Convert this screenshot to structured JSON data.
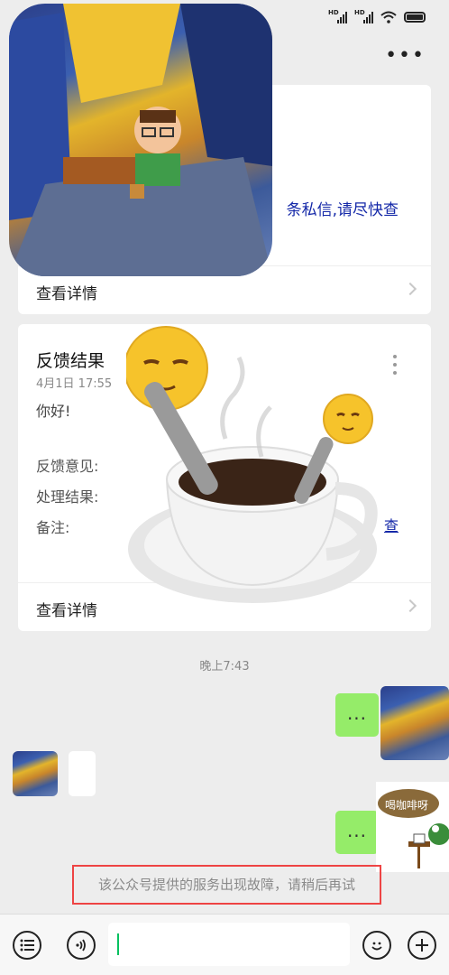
{
  "status_bar": {
    "hd1": "HD",
    "hd2": "HD"
  },
  "header": {
    "more_label": "•••"
  },
  "card1": {
    "link_text": "条私信,请尽快查",
    "footer_label": "查看详情"
  },
  "card2": {
    "title": "反馈结果",
    "date": "4月1日  17:55",
    "greeting": "你好!",
    "feedback_label": "反馈意见:",
    "result_label": "处理结果:",
    "remark_label": "备注:",
    "link_text": "查",
    "footer_label": "查看详情"
  },
  "timestamp": "晚上7:43",
  "messages": {
    "dots1": "...",
    "dots2": "..."
  },
  "sticker_text": "喝咖啡呀",
  "error_message": "该公众号提供的服务出现故障，请稍后再试",
  "icons": {
    "menu": "list-icon",
    "voice": "voice-icon",
    "emoji": "emoji-icon",
    "plus": "plus-icon"
  },
  "colors": {
    "link": "#1428a8",
    "bubble_green": "#95ec69",
    "error_border": "#ee4444"
  }
}
